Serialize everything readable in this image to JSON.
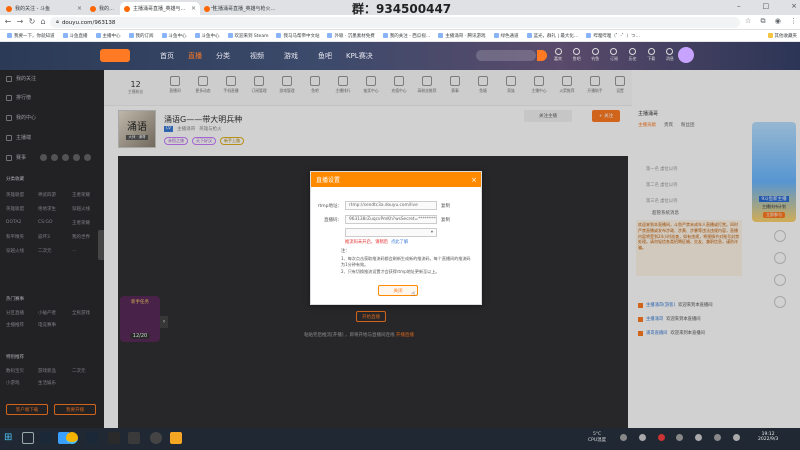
{
  "browser": {
    "tabs": [
      {
        "label": "我的关注 - 斗鱼"
      },
      {
        "label": "我的关注 - 斗鱼"
      },
      {
        "label": "主播涌哥直播_英雄与枪火直播 - 斗鱼"
      },
      {
        "label": "主播涌哥直播_英雄与枪火直播"
      },
      {
        "label": "斗鱼 - 每个人的直播平台"
      }
    ],
    "address": "douyu.com/963138",
    "overlay_text": "群：934500447",
    "bookmarks": [
      "我要一下，你就知道",
      "斗鱼直播",
      "主播中心",
      "我的订阅",
      "斗鱼中心",
      "斗鱼中心",
      "欢迎来到 Steam",
      "我马马帮帝中文站",
      "外联 · 沉墨素材免费",
      "我的关注 - 西瓜视…",
      "主播涌哥 · 腾讯游戏",
      "绿色通道",
      "蓝光，群礼 | 最大化…",
      "哔哩哔哩（゜-゜）つ…",
      "其他收藏夹"
    ]
  },
  "site_nav": {
    "items": [
      "首页",
      "直播",
      "分类",
      "视频",
      "游戏",
      "鱼吧",
      "KPL赛决"
    ],
    "active_index": 1,
    "right_items": [
      "嘉宾",
      "鱼吧",
      "钓鱼",
      "订阅",
      "历史",
      "下载",
      "消息"
    ]
  },
  "sidebar": {
    "items": [
      "我的关注",
      "排行榜",
      "我的中心",
      "主播端",
      "赛事"
    ],
    "sections": [
      {
        "title": "分类收藏",
        "links": [
          "英雄联盟",
          "神武四游",
          "王者荣耀",
          "英雄联盟",
          "绝地求生",
          "穿越火线",
          "DOTA2",
          "CS:GO",
          "王者荣耀",
          "和平精英",
          "崩坏3",
          "我的世界",
          "穿越火线",
          "二次元",
          "…"
        ]
      },
      {
        "title": "热门赛事",
        "links": [
          "分区直播",
          "小破产者",
          "全民游戏",
          "主播推荐",
          "电竞赛事"
        ]
      },
      {
        "title": "特别推荐",
        "links": [
          "数码宝贝",
          "游戏新品",
          "二次元",
          "小游戏",
          "生活娱乐"
        ]
      }
    ],
    "buttons": [
      "客户端下载",
      "我要开播"
    ]
  },
  "categories": [
    "直播间",
    "更多动态",
    "手机直播",
    "订阅管理",
    "游戏管理",
    "鱼吧",
    "主播排行",
    "抽奖中心",
    "充值中心",
    "高粉丝推荐",
    "赛事",
    "鱼塘",
    "家族",
    "主播中心",
    "火箭推荐",
    "开播助手",
    "我的中心",
    "设置"
  ],
  "streamer": {
    "fans_num": "12",
    "fans_label": "主播粉丝",
    "title": "涌语G——带大明兵种",
    "name": "主播涌哥",
    "category": "英雄与枪火",
    "tags": [
      "永恒之旅",
      "天下好汉",
      "新手上路"
    ],
    "follow_label": "+ 关注",
    "follow_count": "关注主播",
    "cover_text": "涌语",
    "cover_badge": "大师 · 涌哥"
  },
  "player": {
    "hint": "粘贴完后推流[开播] ，即将开始与直播间连线",
    "hint_link": "开播直播",
    "start_button": "开始直播",
    "promo_counter": "12/20",
    "promo_label": "新手任务"
  },
  "modal": {
    "title": "直播设置",
    "rtmp_label": "rtmp地址：",
    "rtmp_value": "rtmp://sendtc3a.douyu.com/live",
    "key_label": "直播码：",
    "key_value": "963138rZuqcvPmKh?wsSecret=**********",
    "copy_label": "复制",
    "select_placeholder": "",
    "refresh_label": "刷新",
    "warning": "推流码未开启，请稍后",
    "warning_link": "点此了解",
    "notes_title": "注：",
    "notes": [
      "1、每次点击获取推流码都会刷新生成新的推流码，每个直播间的推流码为1分钟有效。",
      "2、只有切换推流设置才会获得rtmp地址更新至以上。"
    ],
    "ok_button": "关闭"
  },
  "right_panel": {
    "header_button": "PC版开播",
    "chat_title": "主播涌哥",
    "rank_tabs": [
      "主播贡献",
      "贵宾",
      "粉丝团"
    ],
    "rank_items": [
      "第一名 虚位以待",
      "第二名 虚位以待",
      "第三名 虚位以待"
    ],
    "chat_section": "超管系统消息",
    "system_message": "欢迎来到本直播间，斗鱼严禁未成年人直播或打赏。同时严禁直播或发布涉政、涉黄、涉暴等违法违规内容，直播内容将受到24小时巡查，如有违规，将视情节对账号封禁处理。请勿轻信各类招聘征婚、交友、兼职信息，谨防诈骗。",
    "chat_lines": [
      {
        "user": "主播涌哥(游客)",
        "text": "欢迎来到本直播间"
      },
      {
        "user": "主播涌哥",
        "text": "欢迎来到本直播间"
      },
      {
        "user": "涌哥直播间",
        "text": "欢迎来到本直播间"
      }
    ],
    "ad_title": "9斗鱼新主播",
    "ad_text": "主播扶持计划",
    "ad_button": "立即参与"
  },
  "taskbar": {
    "weather": "5°C",
    "weather_sub": "CPU温度",
    "time": "19:12",
    "date": "2022/9/3"
  },
  "colors": {
    "accent": "#ff7a22",
    "modal_head": "#ff8a00",
    "sidebar_bg": "#2a2a2e",
    "header_bg": "#2b3a56"
  }
}
